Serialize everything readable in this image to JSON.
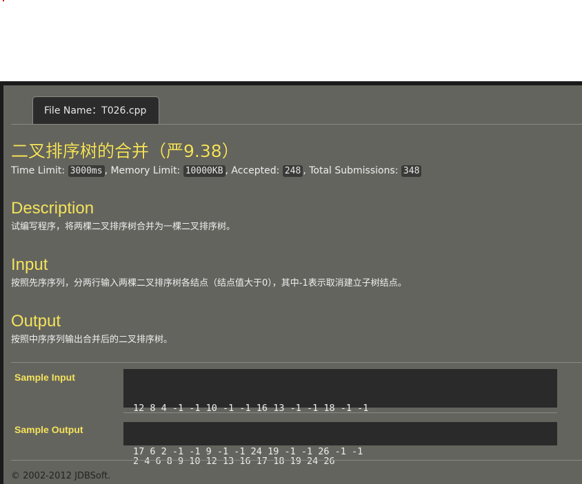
{
  "tab": {
    "label": "File Name：T026.cpp"
  },
  "problem": {
    "title": "二叉排序树的合并（严9.38）",
    "limits": {
      "time_label": "Time Limit:",
      "time_value": "3000ms",
      "memory_label": ", Memory Limit:",
      "memory_value": "10000KB",
      "accepted_label": ", Accepted:",
      "accepted_value": "248",
      "submissions_label": ", Total Submissions:",
      "submissions_value": "348"
    },
    "description_heading": "Description",
    "description_text": "试编写程序，将两棵二叉排序树合并为一棵二叉排序树。",
    "input_heading": "Input",
    "input_text": "按照先序序列，分两行输入两棵二叉排序树各结点（结点值大于0），其中-1表示取消建立子树结点。",
    "output_heading": "Output",
    "output_text": "按照中序序列输出合并后的二叉排序树。"
  },
  "samples": {
    "input_label": "Sample Input",
    "input_lines": [
      "12 8 4 -1 -1 10 -1 -1 16 13 -1 -1 18 -1 -1",
      "17 6 2 -1 -1 9 -1 -1 24 19 -1 -1 26 -1 -1"
    ],
    "output_label": "Sample Output",
    "output_lines": [
      "2 4 6 8 9 10 12 13 16 17 18 19 24 26"
    ]
  },
  "footer": {
    "text": "© 2002-2012  JDBSoft."
  },
  "colors": {
    "accent": "#f4e35a",
    "panel": "#64645f",
    "code_bg": "#2a2a2a"
  }
}
